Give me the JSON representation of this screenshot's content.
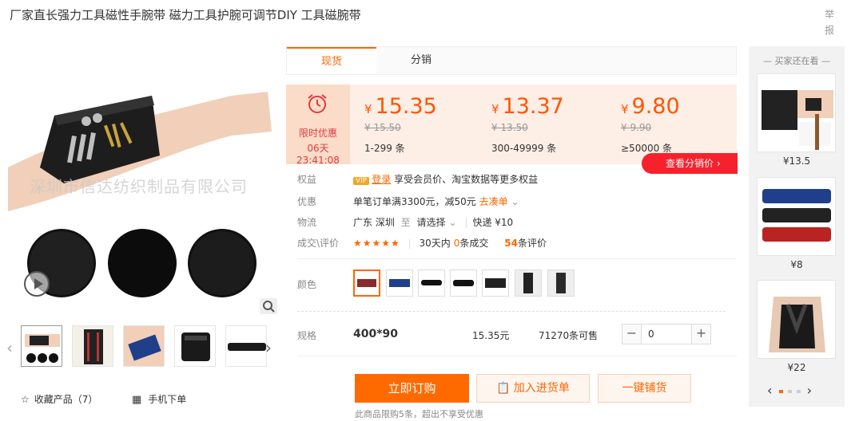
{
  "product": {
    "title": "厂家直长强力工具磁性手腕带 磁力工具护腕可调节DIY 工具磁腕带",
    "report": "举报",
    "watermark": "深圳市信达纺织制品有限公司"
  },
  "gallery": {
    "favorites": "收藏产品（7）",
    "mobile_order": "手机下单",
    "prev_arrow": "‹",
    "next_arrow": "›"
  },
  "tabs": [
    {
      "label": "现货"
    },
    {
      "label": "分销"
    }
  ],
  "promo": {
    "label": "限时优惠",
    "countdown": "06天23:41:08"
  },
  "tiers": [
    {
      "currency": "¥",
      "price": "15.35",
      "old_price": "¥ 15.50",
      "range": "1-299 条"
    },
    {
      "currency": "¥",
      "price": "13.37",
      "old_price": "¥ 13.50",
      "range": "300-49999 条"
    },
    {
      "currency": "¥",
      "price": "9.80",
      "old_price": "¥ 9.90",
      "range": "≥50000 条"
    }
  ],
  "distribution_button": "查看分销价 ›",
  "info": {
    "rights_label": "权益",
    "vip_badge": "VIP",
    "login_link": "登录",
    "rights_text": "享受会员价、淘宝数据等更多权益",
    "discount_label": "优惠",
    "discount_text": "单笔订单满3300元，减50元",
    "discount_link": "去凑单",
    "logistics_label": "物流",
    "logistics_from": "广东 深圳",
    "logistics_to_word": "至",
    "logistics_select": "请选择",
    "logistics_express": "快递 ¥10",
    "deal_label": "成交\\评价",
    "stars": "★★★★★",
    "deals_prefix": "30天内",
    "deals_count": "0",
    "deals_suffix": "条成交",
    "reviews_count": "54",
    "reviews_suffix": "条评价"
  },
  "color_label": "颜色",
  "spec": {
    "label": "规格",
    "name": "400*90",
    "price": "15.35元",
    "stock": "71270条可售",
    "qty": "0",
    "minus": "−",
    "plus": "+"
  },
  "actions": {
    "buy": "立即订购",
    "cart": "加入进货单",
    "onekey": "一键铺货",
    "limit_note": "此商品限购5条，超出不享受优惠"
  },
  "rail": {
    "title": "买家还在看",
    "items": [
      {
        "price": "¥13.5"
      },
      {
        "price": "¥8"
      },
      {
        "price": "¥22"
      }
    ],
    "prev": "‹",
    "next": "›"
  },
  "colors": {
    "accent": "#ff6600",
    "price": "#ff5500",
    "promo_bg": "#fbdcc9",
    "band_bg": "#fdeee6",
    "red": "#f5222d"
  }
}
